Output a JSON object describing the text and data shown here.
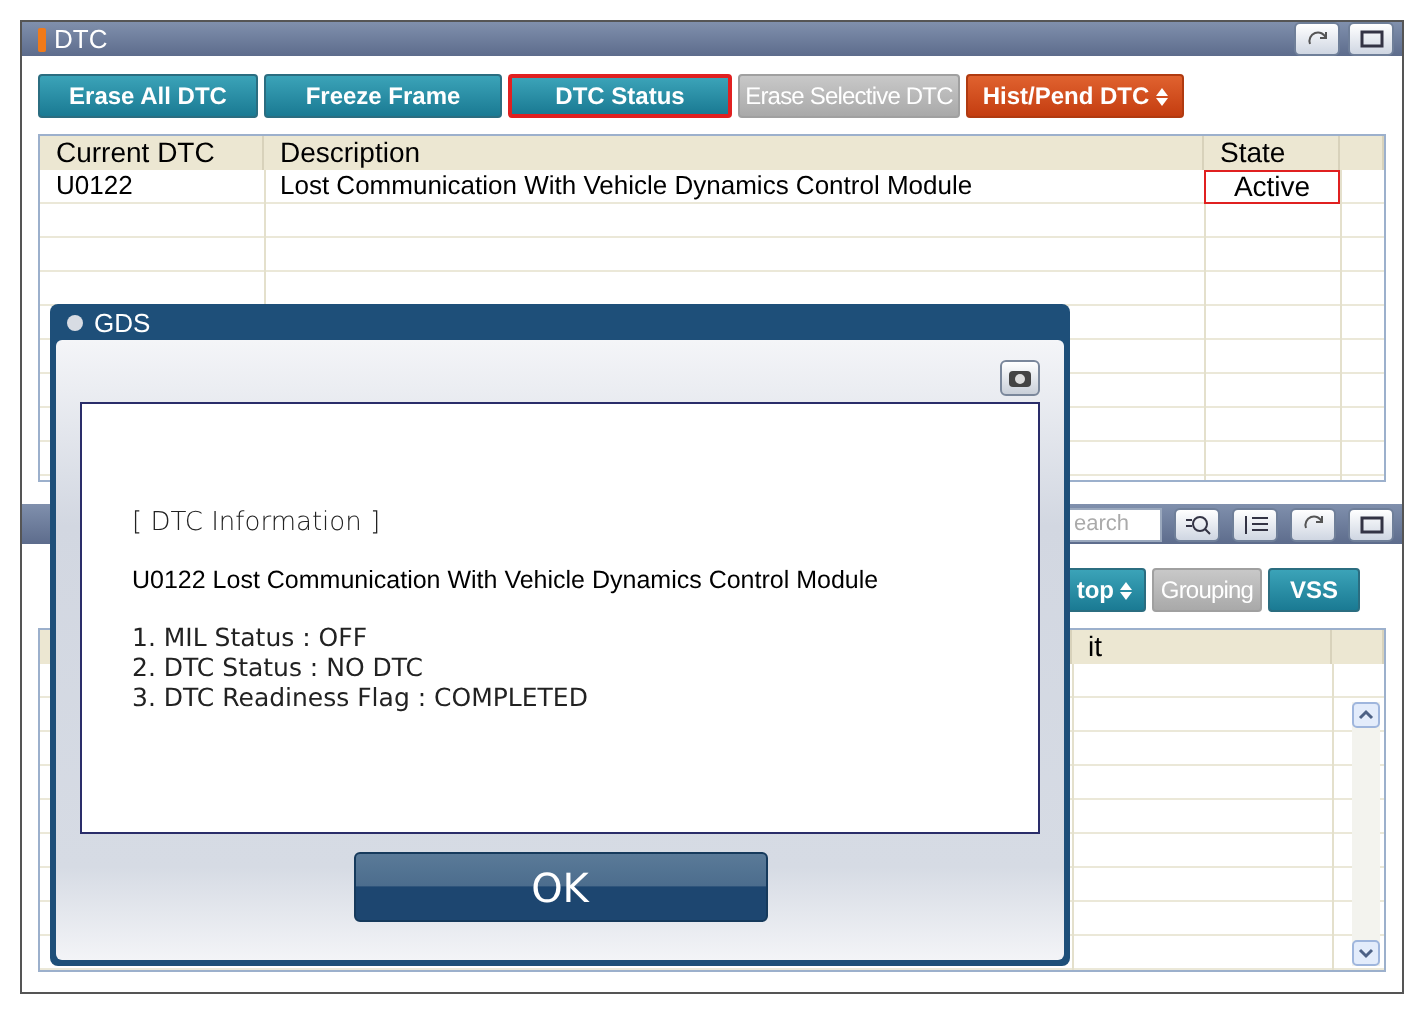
{
  "dtc_window": {
    "title": "DTC",
    "buttons": [
      {
        "label": "Erase All DTC",
        "kind": "action",
        "selected": false
      },
      {
        "label": "Freeze Frame",
        "kind": "action",
        "selected": false
      },
      {
        "label": "DTC Status",
        "kind": "action",
        "selected": true
      },
      {
        "label": "Erase Selective DTC",
        "kind": "disabled",
        "selected": false
      },
      {
        "label": "Hist/Pend DTC",
        "kind": "alert_menu",
        "selected": false
      }
    ],
    "table": {
      "columns": [
        "Current DTC",
        "Description",
        "State"
      ],
      "rows": [
        {
          "cells": [
            "U0122",
            "Lost Communication With Vehicle Dynamics Control Module",
            "Active"
          ],
          "state_flagged": true
        }
      ]
    }
  },
  "data_window": {
    "search": {
      "placeholder": "earch"
    },
    "buttons": [
      {
        "label": "top",
        "kind": "menu"
      },
      {
        "label": "Grouping",
        "kind": "disabled"
      },
      {
        "label": "VSS",
        "kind": "action"
      }
    ],
    "columns": [
      "it"
    ]
  },
  "dialog": {
    "title": "GDS",
    "heading": "[ DTC Information ]",
    "code_line": "U0122 Lost Communication With Vehicle Dynamics Control Module",
    "items": [
      "1. MIL Status : OFF",
      "2. DTC Status : NO DTC",
      "3. DTC Readiness Flag : COMPLETED"
    ],
    "ok": "OK"
  }
}
